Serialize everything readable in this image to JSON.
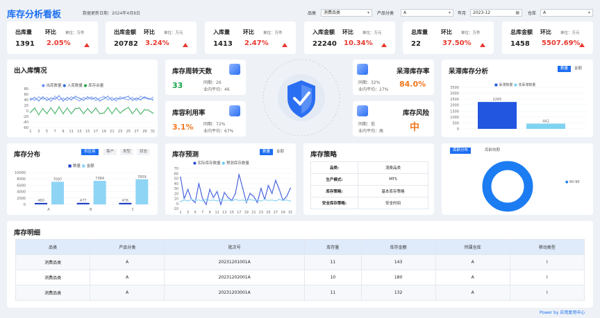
{
  "header": {
    "title": "库存分析看板",
    "date": "数据更新日期：2024年4月8日"
  },
  "filters": {
    "cat_label": "品类",
    "cat_value": "消费品类",
    "pcat_label": "产品分类",
    "pcat_value": "A",
    "ym_label": "年月",
    "ym_value": "2023-12",
    "wh_label": "仓库",
    "wh_value": "A"
  },
  "kpis": [
    {
      "name": "出库量",
      "yoy_label": "环比",
      "unit": "单位：万件",
      "value": "1391",
      "pct": "2.05%"
    },
    {
      "name": "出库金额",
      "yoy_label": "环比",
      "unit": "单位：万元",
      "value": "20782",
      "pct": "3.24%"
    },
    {
      "name": "入库量",
      "yoy_label": "环比",
      "unit": "单位：万件",
      "value": "1413",
      "pct": "2.47%"
    },
    {
      "name": "入库金额",
      "yoy_label": "环比",
      "unit": "单位：万元",
      "value": "22240",
      "pct": "10.34%"
    },
    {
      "name": "总库量",
      "yoy_label": "环比",
      "unit": "单位：万件",
      "value": "22",
      "pct": "37.50%"
    },
    {
      "name": "总库金额",
      "yoy_label": "环比",
      "unit": "单位：万元",
      "value": "1458",
      "pct": "5507.69%"
    }
  ],
  "inout": {
    "title": "出入库情况",
    "legend": [
      "出库数量",
      "入库数量",
      "库存余量"
    ],
    "x": [
      "1",
      "3",
      "5",
      "7",
      "9",
      "11",
      "13",
      "15",
      "17",
      "19",
      "21",
      "23",
      "25",
      "27",
      "29",
      "31"
    ],
    "yticks": [
      "80",
      "60",
      "40",
      "20",
      "0",
      "-20",
      "-40",
      "-60"
    ]
  },
  "turnover": {
    "title": "库存周转天数",
    "value": "33",
    "tb": "同期：26",
    "avg": "业内平均：46"
  },
  "util": {
    "title": "库容利用率",
    "value": "3.1%",
    "tb": "同期：72%",
    "avg": "业内平均：67%"
  },
  "stagnant": {
    "title": "呆滞库存率",
    "value": "84.0%",
    "tb": "同期：32%",
    "avg": "业内平均：27%"
  },
  "risk": {
    "title": "库存风险",
    "value": "中",
    "tb": "同期：低",
    "avg": "业内平均：高"
  },
  "stagAnalysis": {
    "title": "呆滞库存分析",
    "tab1": "数量",
    "tab2": "金额",
    "legend": [
      "呆滞数量",
      "非呆滞数量"
    ],
    "yticks": [
      "3500",
      "3000",
      "2500",
      "2000",
      "1500",
      "1000",
      "500",
      "0"
    ]
  },
  "dist": {
    "title": "库存分布",
    "tabs": [
      "供应商",
      "客户",
      "类型",
      "状态"
    ],
    "legend": [
      "数量",
      "金额"
    ],
    "yticks": [
      "10000",
      "8000",
      "6000",
      "4000",
      "2000",
      "0"
    ]
  },
  "forecast": {
    "title": "库存预测",
    "tab1": "数量",
    "tab2": "金额",
    "legend": [
      "实际库存数量",
      "预测库存数量"
    ],
    "yticks": [
      "70",
      "60",
      "50",
      "40",
      "30",
      "20",
      "10",
      "0",
      "-10"
    ],
    "x": [
      "1",
      "3",
      "5",
      "7",
      "9",
      "11",
      "13",
      "15",
      "17",
      "19",
      "21",
      "23",
      "25",
      "27",
      "29",
      "31"
    ]
  },
  "strategy": {
    "title": "库存策略",
    "rows": [
      [
        "品类:",
        "消费品类"
      ],
      [
        "生产模式:",
        "MTS"
      ],
      [
        "库存策略:",
        "基本库存策略"
      ],
      [
        "安全库存策略:",
        "安全时间"
      ]
    ]
  },
  "age": {
    "tab1": "库龄分布",
    "tab2": "库龄效期",
    "legend": "60-90"
  },
  "detail": {
    "title": "库存明细",
    "headers": [
      "品类",
      "产品分类",
      "批次号",
      "库存量",
      "库存金额",
      "所属仓库",
      "移动类型"
    ],
    "rows": [
      [
        "消费品类",
        "A",
        "20231201001A",
        "11",
        "143",
        "A",
        "I"
      ],
      [
        "消费品类",
        "A",
        "20231202001A",
        "10",
        "180",
        "A",
        "I"
      ],
      [
        "消费品类",
        "A",
        "20231203001A",
        "11",
        "132",
        "A",
        "I"
      ]
    ]
  },
  "footer": "Power by 应用复用中心",
  "colors": {
    "accent": "#1c6ef2",
    "red": "#e8382f",
    "green": "#16a34a",
    "orange": "#f0781e"
  },
  "chart_data": [
    {
      "type": "line",
      "title": "出入库情况",
      "x": [
        1,
        2,
        3,
        4,
        5,
        6,
        7,
        8,
        9,
        10,
        11,
        12,
        13,
        14,
        15,
        16,
        17,
        18,
        19,
        20,
        21,
        22,
        23,
        24,
        25,
        26,
        27,
        28,
        29,
        30,
        31
      ],
      "series": [
        {
          "name": "出库数量",
          "values": [
            45,
            38,
            50,
            42,
            48,
            35,
            52,
            40,
            46,
            38,
            50,
            44,
            36,
            48,
            42,
            50,
            38,
            46,
            52,
            40,
            48,
            36,
            50,
            44,
            40,
            48,
            38,
            52,
            46,
            42,
            48
          ]
        },
        {
          "name": "入库数量",
          "values": [
            40,
            48,
            36,
            50,
            38,
            46,
            42,
            54,
            36,
            48,
            40,
            52,
            46,
            38,
            50,
            42,
            48,
            36,
            44,
            52,
            38,
            46,
            42,
            48,
            52,
            38,
            46,
            40,
            50,
            44,
            40
          ]
        },
        {
          "name": "库存余量",
          "values": [
            -5,
            10,
            -14,
            8,
            -10,
            11,
            -10,
            14,
            -10,
            10,
            -10,
            8,
            10,
            -10,
            8,
            -8,
            10,
            -10,
            -8,
            12,
            -10,
            10,
            -8,
            4,
            12,
            -10,
            8,
            -12,
            4,
            2,
            -8
          ]
        }
      ],
      "ylim": [
        -60,
        80
      ]
    },
    {
      "type": "bar",
      "title": "呆滞库存分析",
      "categories": [
        ""
      ],
      "series": [
        {
          "name": "呆滞数量",
          "values": [
            2265
          ]
        },
        {
          "name": "非呆滞数量",
          "values": [
            442
          ]
        }
      ],
      "ylim": [
        0,
        3500
      ]
    },
    {
      "type": "bar",
      "title": "库存分布",
      "categories": [
        "A",
        "B",
        "C"
      ],
      "series": [
        {
          "name": "数量",
          "values": [
            460,
            477,
            476
          ]
        },
        {
          "name": "金额",
          "values": [
            7097,
            7384,
            7859
          ]
        }
      ],
      "ylim": [
        0,
        10000
      ]
    },
    {
      "type": "line",
      "title": "库存预测",
      "x": [
        1,
        2,
        3,
        4,
        5,
        6,
        7,
        8,
        9,
        10,
        11,
        12,
        13,
        14,
        15,
        16,
        17,
        18,
        19,
        20,
        21,
        22,
        23,
        24,
        25,
        26,
        27,
        28,
        29,
        30,
        31
      ],
      "series": [
        {
          "name": "实际库存数量",
          "values": [
            52,
            10,
            28,
            8,
            2,
            40,
            10,
            -2,
            28,
            12,
            24,
            -2,
            22,
            12,
            6,
            20,
            58,
            30,
            2,
            20,
            14,
            2,
            30,
            8,
            36,
            20,
            46,
            28,
            6,
            14,
            30
          ]
        },
        {
          "name": "预测库存数量",
          "values": [
            4,
            7,
            5,
            8,
            6,
            7,
            5,
            8,
            6,
            7,
            5,
            8,
            6,
            7,
            5,
            8,
            6,
            7,
            5,
            8,
            6,
            7,
            5,
            8,
            6,
            7,
            5,
            8,
            6,
            7,
            5
          ]
        }
      ],
      "ylim": [
        -10,
        70
      ]
    },
    {
      "type": "pie",
      "title": "库龄分布",
      "categories": [
        "60-90"
      ],
      "values": [
        100
      ]
    }
  ]
}
